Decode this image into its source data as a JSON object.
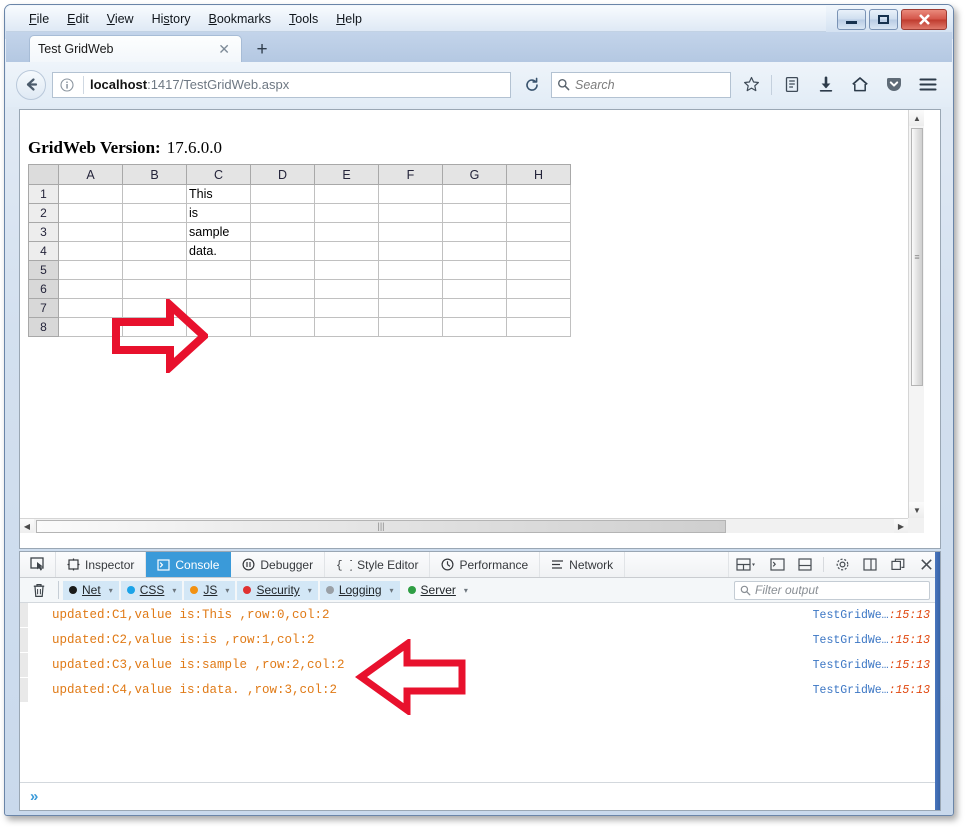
{
  "window": {
    "caption_buttons": [
      {
        "name": "minimize",
        "glyph": "—"
      },
      {
        "name": "restore",
        "glyph": "❐"
      },
      {
        "name": "close",
        "glyph": "✕"
      }
    ]
  },
  "menubar": [
    {
      "pre": "",
      "key": "F",
      "post": "ile"
    },
    {
      "pre": "",
      "key": "E",
      "post": "dit"
    },
    {
      "pre": "",
      "key": "V",
      "post": "iew"
    },
    {
      "pre": "Hi",
      "key": "s",
      "post": "tory"
    },
    {
      "pre": "",
      "key": "B",
      "post": "ookmarks"
    },
    {
      "pre": "",
      "key": "T",
      "post": "ools"
    },
    {
      "pre": "",
      "key": "H",
      "post": "elp"
    }
  ],
  "tabs": {
    "active_title": "Test GridWeb",
    "close_glyph": "✕",
    "newtab_glyph": "+"
  },
  "navbar": {
    "back_icon": "back-arrow-icon",
    "identity_icon": "info-circle-icon",
    "url_bold": "localhost",
    "url_rest": ":1417/TestGridWeb.aspx",
    "reload_glyph": "⟳",
    "search_placeholder": "Search",
    "icons": [
      "star-icon",
      "library-icon",
      "download-icon",
      "home-icon",
      "pocket-icon",
      "menu-icon"
    ]
  },
  "page": {
    "version_label": "GridWeb Version:",
    "version_value": "17.6.0.0",
    "grid": {
      "columns": [
        "A",
        "B",
        "C",
        "D",
        "E",
        "F",
        "G",
        "H"
      ],
      "rows": [
        {
          "header": "1",
          "active": true,
          "cells": [
            "",
            "",
            "This",
            "",
            "",
            "",
            "",
            ""
          ]
        },
        {
          "header": "2",
          "active": true,
          "cells": [
            "",
            "",
            "is",
            "",
            "",
            "",
            "",
            ""
          ]
        },
        {
          "header": "3",
          "active": true,
          "cells": [
            "",
            "",
            "sample",
            "",
            "",
            "",
            "",
            ""
          ]
        },
        {
          "header": "4",
          "active": true,
          "cells": [
            "",
            "",
            "data.",
            "",
            "",
            "",
            "",
            ""
          ]
        },
        {
          "header": "5",
          "active": false,
          "cells": [
            "",
            "",
            "",
            "",
            "",
            "",
            "",
            ""
          ]
        },
        {
          "header": "6",
          "active": false,
          "cells": [
            "",
            "",
            "",
            "",
            "",
            "",
            "",
            ""
          ]
        },
        {
          "header": "7",
          "active": false,
          "cells": [
            "",
            "",
            "",
            "",
            "",
            "",
            "",
            ""
          ]
        },
        {
          "header": "8",
          "active": false,
          "cells": [
            "",
            "",
            "",
            "",
            "",
            "",
            "",
            ""
          ]
        }
      ]
    }
  },
  "annotations": {
    "arrow_color": "#E8112D",
    "grid_arrow": {
      "direction": "right",
      "points_at": "column C data"
    },
    "console_arrow": {
      "direction": "left",
      "points_at": "console log messages"
    }
  },
  "devtools": {
    "picker_icon": "element-picker-icon",
    "tabs": [
      {
        "label": "Inspector",
        "icon": "inspector-icon",
        "active": false
      },
      {
        "label": "Console",
        "icon": "console-icon",
        "active": true
      },
      {
        "label": "Debugger",
        "icon": "debugger-icon",
        "active": false
      },
      {
        "label": "Style Editor",
        "icon": "style-editor-icon",
        "active": false
      },
      {
        "label": "Performance",
        "icon": "performance-icon",
        "active": false
      },
      {
        "label": "Network",
        "icon": "network-icon",
        "active": false
      }
    ],
    "commands": [
      {
        "name": "responsive-design-mode-icon",
        "glyph": "▤"
      },
      {
        "name": "split-console-icon",
        "glyph": "▣"
      },
      {
        "name": "dock-bottom-icon",
        "glyph": "▤"
      },
      {
        "name": "settings-gear-icon",
        "glyph": "⚙"
      },
      {
        "name": "dock-side-icon",
        "glyph": "▯"
      },
      {
        "name": "separate-window-icon",
        "glyph": "❐"
      },
      {
        "name": "close-icon",
        "glyph": "✕"
      }
    ],
    "trash_icon": "trash-icon",
    "categories": [
      {
        "label_pre": "",
        "label_key": "N",
        "label_post": "et",
        "color": "#1a1a1a",
        "on": true
      },
      {
        "label_pre": "",
        "label_key": "C",
        "label_post": "SS",
        "color": "#1aa3e8",
        "on": true
      },
      {
        "label_pre": "",
        "label_key": "J",
        "label_post": "S",
        "color": "#f29111",
        "on": true
      },
      {
        "label_pre": "",
        "label_key": "S",
        "label_post": "ecurity",
        "color": "#e03131",
        "on": true
      },
      {
        "label_pre": "",
        "label_key": "L",
        "label_post": "ogging",
        "color": "#9aa0a6",
        "on": true
      },
      {
        "label_pre": "",
        "label_key": "S",
        "label_post": "erver",
        "color": "#2f9e44",
        "on": false
      }
    ],
    "caret_glyph": "▾",
    "filter_placeholder": "Filter output",
    "logs": [
      {
        "message": "updated:C1,value is:This ,row:0,col:2",
        "file": "TestGridWe…",
        "position": ":15:13"
      },
      {
        "message": "updated:C2,value is:is ,row:1,col:2",
        "file": "TestGridWe…",
        "position": ":15:13"
      },
      {
        "message": "updated:C3,value is:sample ,row:2,col:2",
        "file": "TestGridWe…",
        "position": ":15:13"
      },
      {
        "message": "updated:C4,value is:data. ,row:3,col:2",
        "file": "TestGridWe…",
        "position": ":15:13"
      }
    ],
    "prompt_glyph": "»"
  }
}
